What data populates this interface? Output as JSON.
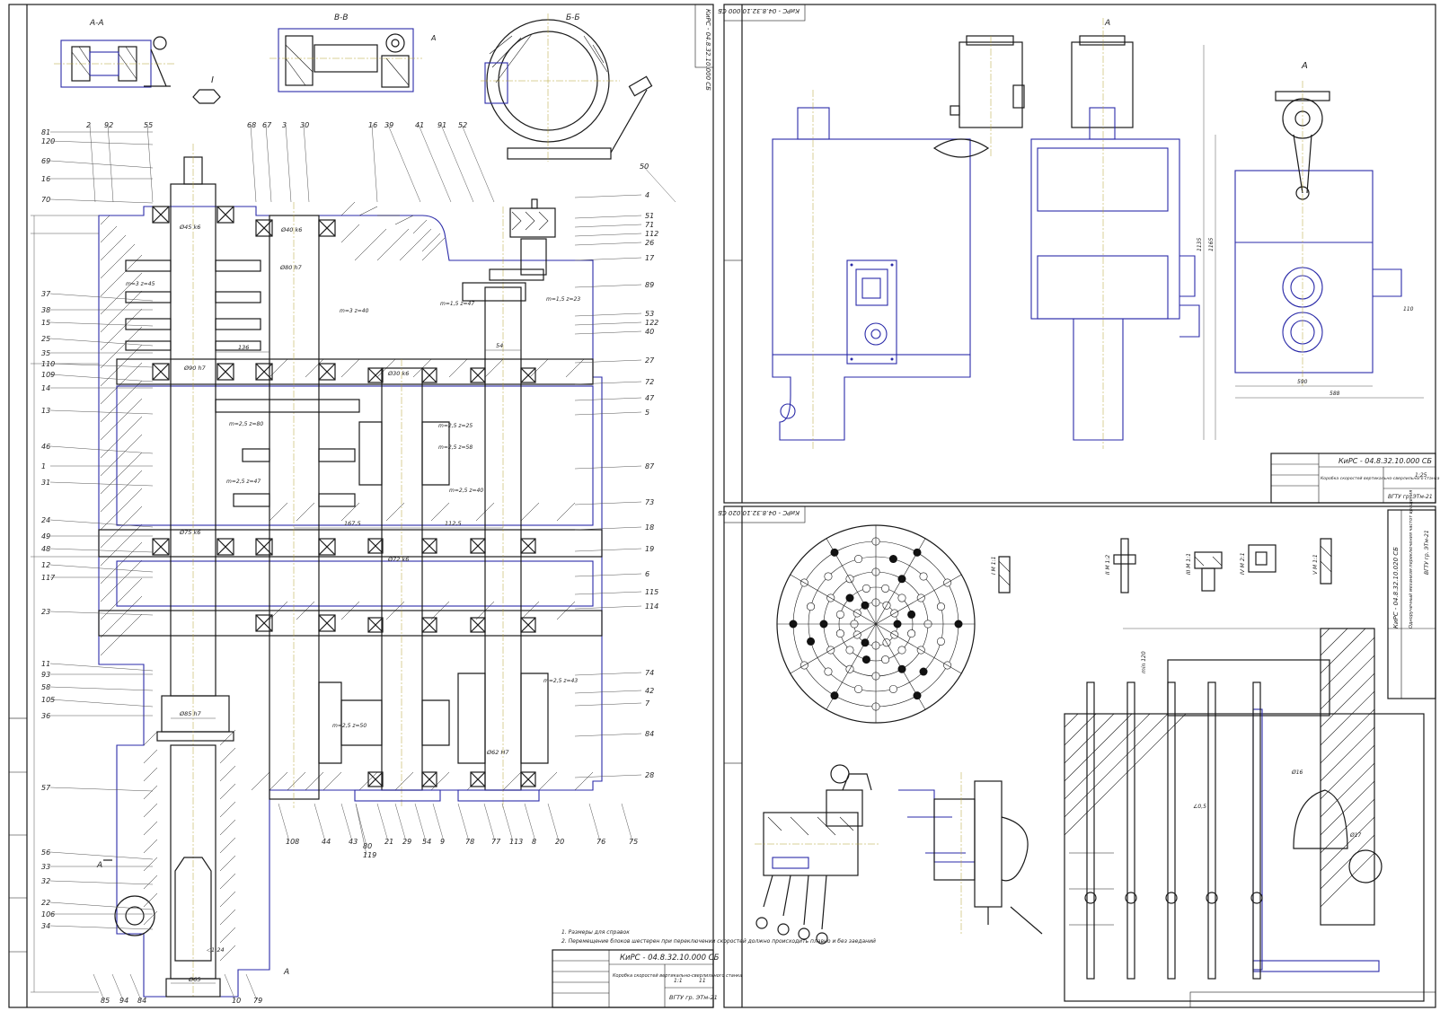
{
  "sheet1": {
    "sections": [
      "A-A",
      "В-В",
      "Б-Б",
      "I"
    ],
    "title_block": {
      "designation": "КиРС - 04.8.32.10.000 СБ",
      "name": "Коробка скоростей вертикально-сверлильного станка",
      "sheet_no": "11",
      "group": "ВГТУ гр. ЭТм-21",
      "scale": "1:1"
    },
    "notes": [
      "1. Размеры для справок",
      "2. Перемещение блоков шестерен при переключении скоростей должно происходить плавно и без заеданий"
    ],
    "stamp": "КиРС - 04.8.32.10.000 СБ",
    "gear_labels": [
      "m=3 z=45",
      "m=3 z=40",
      "m=2,5 z=47",
      "m=2,5 z=58",
      "m=2,5 z=40",
      "m=2,5 z=80",
      "m=2,5 z=25",
      "m=2,5 z=43",
      "m=2,5 z=50",
      "m=1,5 z=47",
      "m=1,5 z=23"
    ],
    "dims": [
      "136",
      "167,5",
      "112,5",
      "54",
      "Ø85 h7",
      "Ø45 k6",
      "Ø72 k6",
      "Ø80 h7",
      "Ø30 k6",
      "Ø40 k6",
      "Ø62 H7",
      "Ø75 k6",
      "Ø65",
      "◁1:24",
      "Ø90 h7"
    ],
    "left_numbers": [
      "81",
      "120",
      "69",
      "16",
      "70",
      "37",
      "38",
      "15",
      "25",
      "35",
      "110",
      "109",
      "14",
      "13",
      "46",
      "1",
      "31",
      "24",
      "49",
      "48",
      "12",
      "117",
      "23",
      "11",
      "93",
      "58",
      "105",
      "36",
      "57",
      "56",
      "33",
      "32",
      "22",
      "106",
      "34"
    ],
    "top_numbers": [
      "2",
      "92",
      "55",
      "68",
      "67",
      "3",
      "30",
      "16",
      "39",
      "41",
      "91",
      "52",
      "50"
    ],
    "right_numbers": [
      "4",
      "51",
      "71",
      "112",
      "26",
      "17",
      "89",
      "53",
      "122",
      "40",
      "27",
      "72",
      "47",
      "5",
      "87",
      "73",
      "18",
      "19",
      "6",
      "115",
      "114",
      "74",
      "42",
      "7",
      "84",
      "28"
    ],
    "bottom_numbers": [
      "85",
      "94",
      "84",
      "10",
      "79",
      "108",
      "44",
      "43",
      "80",
      "119",
      "21",
      "29",
      "54",
      "9",
      "78",
      "77",
      "113",
      "8",
      "20",
      "76",
      "75"
    ]
  },
  "sheet2": {
    "stamp": "КиРС - 04.8.32.10.000 СБ",
    "view_label": "A",
    "dims": [
      "1135",
      "1165",
      "590",
      "588",
      "110"
    ],
    "title_block": {
      "designation": "КиРС - 04.8.32.10.000 СБ",
      "name": "Коробка скоростей вертикально-сверлильного станка",
      "scale": "1:25",
      "group": "ВГТУ гр. ЭТм-21"
    }
  },
  "sheet3": {
    "stamp": "КиРС - 04.8.32.10.020 СБ",
    "detail_labels": [
      "I М 1:1",
      "II М 1:2",
      "III М 1:1",
      "IV М 2:1",
      "V М 1:1"
    ],
    "title_block": {
      "designation": "КиРС - 04.8.32.10.020 СБ",
      "name": "Одноручечный механизм переключения частот вращения",
      "group": "ВГТУ гр. ЭТм-21"
    },
    "dims": [
      "Ø16",
      "∠0,5",
      "Ø17",
      "min 120"
    ]
  }
}
